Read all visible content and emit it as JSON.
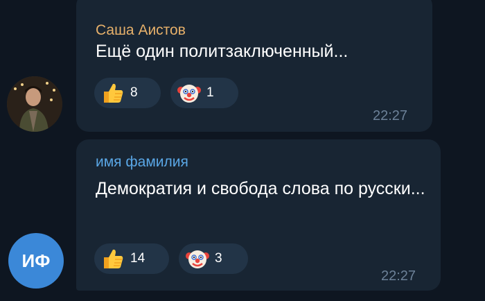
{
  "messages": [
    {
      "sender": "Саша Аистов",
      "sender_color": "#e6b06a",
      "text": "Ещё один политзаключенный...",
      "reactions": [
        {
          "icon": "thumbs-up-icon",
          "count": "8"
        },
        {
          "icon": "clown-icon",
          "count": "1"
        }
      ],
      "time": "22:27"
    },
    {
      "sender": "имя фамилия",
      "sender_color": "#5aa7e6",
      "text": "Демократия и свобода слова по русски...",
      "reactions": [
        {
          "icon": "thumbs-up-icon",
          "count": "14"
        },
        {
          "icon": "clown-icon",
          "count": "3"
        }
      ],
      "time": "22:27",
      "avatar_initials": "ИФ"
    }
  ],
  "colors": {
    "background": "#0e1621",
    "bubble": "#182533",
    "reaction": "#223447",
    "time": "#6c8198",
    "avatar_blue": "#3b88d8"
  }
}
